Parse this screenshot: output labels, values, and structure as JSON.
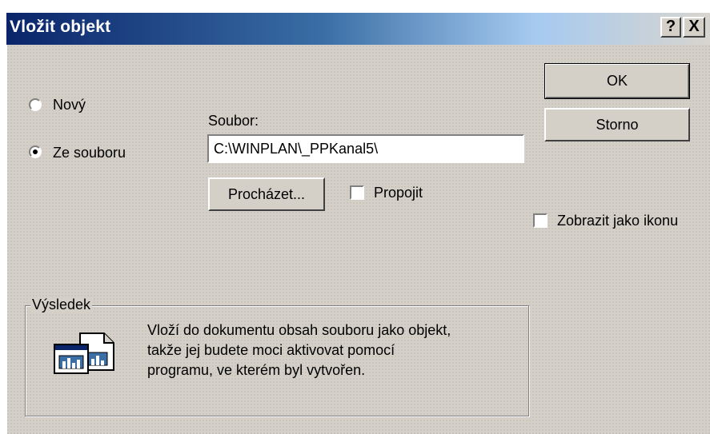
{
  "window": {
    "title": "Vložit objekt",
    "help_glyph": "?",
    "close_glyph": "X"
  },
  "options": {
    "new_label": "Nový",
    "from_file_label": "Ze souboru",
    "selected": "from_file"
  },
  "file": {
    "label": "Soubor:",
    "value": "C:\\WINPLAN\\_PPKanal5\\"
  },
  "buttons": {
    "ok": "OK",
    "cancel": "Storno",
    "browse": "Procházet..."
  },
  "checkboxes": {
    "link_label": "Propojit",
    "link_checked": false,
    "display_as_icon_label": "Zobrazit jako ikonu",
    "display_as_icon_checked": false
  },
  "result": {
    "legend": "Výsledek",
    "lines": [
      "Vloží do dokumentu obsah souboru jako objekt,",
      "takže jej budete moci aktivovat pomocí",
      "programu, ve kterém byl vytvořen."
    ],
    "icon": "embedded-file-icon"
  }
}
